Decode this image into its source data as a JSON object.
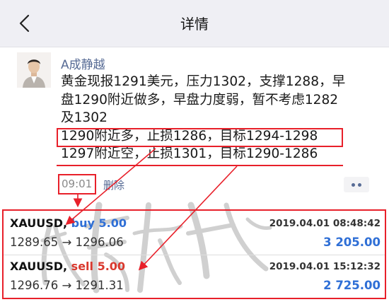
{
  "nav": {
    "title": "详情"
  },
  "post": {
    "author": "A成静越",
    "lines": [
      "黄金现报1291美元，压力1302，支撑1288，早",
      "盘1290附近做多，早盘力度弱，暂不考虑1282",
      "及1302",
      "1290附近多，止损1286，目标1294-1298",
      "1297附近空，止损1301，目标1290-1286"
    ],
    "time": "09:01",
    "delete_label": "删除"
  },
  "trades": [
    {
      "symbol": "XAUUSD,",
      "direction": "buy 5.00",
      "date": "2019.04.01 08:48:42",
      "prices": "1289.65 → 1296.06",
      "profit": "3 205.00"
    },
    {
      "symbol": "XAUUSD,",
      "direction": "sell 5.00",
      "date": "2019.04.01 15:12:32",
      "prices": "1296.76 → 1291.31",
      "profit": "2 725.00"
    }
  ],
  "colors": {
    "accent_red": "#e8202a",
    "link_blue": "#576b95",
    "buy_blue": "#2f6fd6",
    "sell_red": "#d9392e"
  },
  "icons": {
    "back": "chevron-left-icon",
    "more": "more-dots-icon"
  }
}
